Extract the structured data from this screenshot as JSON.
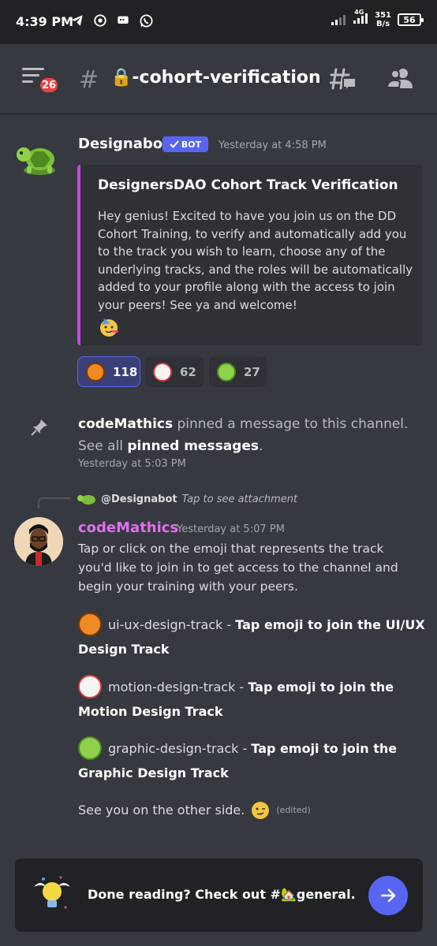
{
  "status_bar": {
    "time": "4:39 PM",
    "network": "4G",
    "speed_value": "351",
    "speed_unit": "B/s",
    "battery": "56"
  },
  "header": {
    "unread_badge": "26",
    "channel_name": "🔒-cohort-verification"
  },
  "bot_message": {
    "author": "Designabot",
    "bot_tag": "BOT",
    "timestamp": "Yesterday at 4:58 PM",
    "embed_title": "DesignersDAO Cohort Track Verification",
    "embed_body": "Hey genius! Excited to have you join us on the DD Cohort Training, to verify and automatically add you to the track you wish to learn, choose any of the underlying tracks, and the roles will be automatically added to your profile along with the access to join your peers! See ya and welcome!",
    "reactions": [
      {
        "emoji": "basketball",
        "count": "118",
        "selected": true
      },
      {
        "emoji": "baseball",
        "count": "62",
        "selected": false
      },
      {
        "emoji": "tennis-ball",
        "count": "27",
        "selected": false
      }
    ]
  },
  "system_message": {
    "actor": "codeMathics",
    "text": " pinned a message to this channel. See all ",
    "link": "pinned messages",
    "end": ".",
    "timestamp": "Yesterday at 5:03 PM"
  },
  "reply": {
    "to": "@Designabot",
    "hint": "Tap to see attachment"
  },
  "user_message": {
    "author": "codeMathics",
    "timestamp": "Yesterday at 5:07 PM",
    "intro": "Tap or click on the emoji that represents the track you'd like to join in to get access to the channel and begin your training with your peers.",
    "tracks": [
      {
        "emoji": "basketball",
        "name": "ui-ux-design-track",
        "sep": " - ",
        "action": "Tap emoji to join the UI/UX Design Track"
      },
      {
        "emoji": "baseball",
        "name": "motion-design-track",
        "sep": " - ",
        "action": "Tap emoji to join the Motion Design Track"
      },
      {
        "emoji": "tennis-ball",
        "name": "graphic-design-track",
        "sep": " - ",
        "action": "Tap emoji to join the Graphic Design Track"
      }
    ],
    "outro": "See you on the other side.",
    "edited": "(edited)"
  },
  "banner": {
    "text": "Done reading? Check out #🏡general."
  },
  "colors": {
    "background": "#36393f",
    "blurple": "#5865f2",
    "embed_accent": "#c548e8",
    "author_user": "#e06ff0",
    "badge_red": "#ed4245"
  }
}
